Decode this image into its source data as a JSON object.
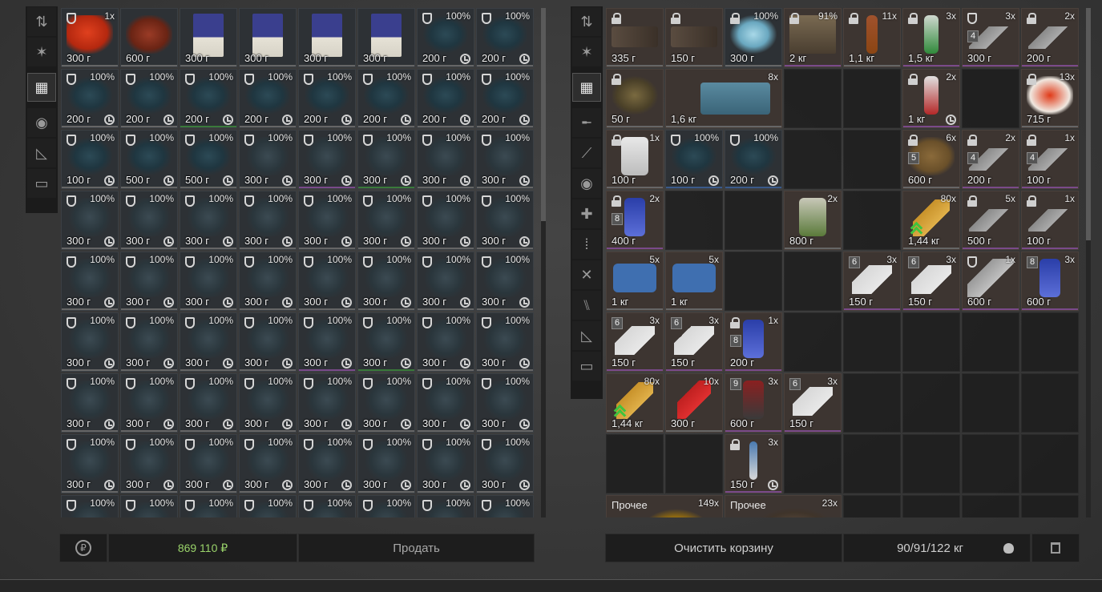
{
  "left_sidebar": [
    "sort-icon",
    "star-icon",
    "grid-icon",
    "ball-icon",
    "ruler-icon",
    "archive-icon"
  ],
  "right_sidebar": [
    "sort-icon",
    "star-icon",
    "grid-icon",
    "rifle-icon",
    "knife-icon",
    "ball-icon",
    "medkit-icon",
    "ammo-icon",
    "tools-icon",
    "food-icon",
    "ruler-icon",
    "archive-icon"
  ],
  "left_items": [
    {
      "art": "meat",
      "mark": "shield",
      "badge": "1x",
      "weight": "300 г",
      "u": "u-grey"
    },
    {
      "art": "heart",
      "badge": "",
      "weight": "600 г",
      "u": "u-grey"
    },
    {
      "art": "book",
      "weight": "300 г",
      "u": "u-grey"
    },
    {
      "art": "book",
      "weight": "300 г",
      "u": "u-grey"
    },
    {
      "art": "book",
      "weight": "300 г",
      "u": "u-grey"
    },
    {
      "art": "book",
      "weight": "300 г",
      "u": "u-grey"
    },
    {
      "art": "coral",
      "mark": "shield",
      "badge": "100%",
      "weight": "200 г",
      "clock": true,
      "u": "u-grey"
    },
    {
      "art": "coral",
      "mark": "shield",
      "badge": "100%",
      "weight": "200 г",
      "clock": true,
      "u": "u-grey"
    },
    {
      "art": "coral",
      "mark": "shield",
      "badge": "100%",
      "weight": "200 г",
      "clock": true,
      "u": "u-grey"
    },
    {
      "art": "coral",
      "mark": "shield",
      "badge": "100%",
      "weight": "200 г",
      "clock": true,
      "u": "u-grey"
    },
    {
      "art": "coral",
      "mark": "shield",
      "badge": "100%",
      "weight": "200 г",
      "clock": true,
      "u": "u-green"
    },
    {
      "art": "coral",
      "mark": "shield",
      "badge": "100%",
      "weight": "200 г",
      "clock": true,
      "u": "u-grey"
    },
    {
      "art": "coral",
      "mark": "shield",
      "badge": "100%",
      "weight": "200 г",
      "clock": true,
      "u": "u-grey"
    },
    {
      "art": "coral",
      "mark": "shield",
      "badge": "100%",
      "weight": "200 г",
      "clock": true,
      "u": "u-grey"
    },
    {
      "art": "coral",
      "mark": "shield",
      "badge": "100%",
      "weight": "200 г",
      "clock": true,
      "u": "u-grey"
    },
    {
      "art": "coral",
      "mark": "shield",
      "badge": "100%",
      "weight": "200 г",
      "clock": true,
      "u": "u-grey"
    },
    {
      "art": "coral",
      "mark": "shield",
      "badge": "100%",
      "weight": "100 г",
      "clock": true,
      "u": "u-grey"
    },
    {
      "art": "coral",
      "mark": "shield",
      "badge": "100%",
      "weight": "500 г",
      "clock": true,
      "u": "u-grey"
    },
    {
      "art": "coral",
      "mark": "shield",
      "badge": "100%",
      "weight": "500 г",
      "clock": true,
      "u": "u-grey"
    },
    {
      "art": "bush",
      "mark": "shield",
      "badge": "100%",
      "weight": "300 г",
      "clock": true,
      "u": "u-grey"
    },
    {
      "art": "bush",
      "mark": "shield",
      "badge": "100%",
      "weight": "300 г",
      "clock": true,
      "u": "u-purple"
    },
    {
      "art": "bush",
      "mark": "shield",
      "badge": "100%",
      "weight": "300 г",
      "clock": true,
      "u": "u-green"
    },
    {
      "art": "bush",
      "mark": "shield",
      "badge": "100%",
      "weight": "300 г",
      "clock": true,
      "u": "u-grey"
    },
    {
      "art": "bush",
      "mark": "shield",
      "badge": "100%",
      "weight": "300 г",
      "clock": true,
      "u": "u-grey"
    },
    {
      "art": "bush",
      "mark": "shield",
      "badge": "100%",
      "weight": "300 г",
      "clock": true,
      "u": "u-grey"
    },
    {
      "art": "bush",
      "mark": "shield",
      "badge": "100%",
      "weight": "300 г",
      "clock": true,
      "u": "u-grey"
    },
    {
      "art": "bush",
      "mark": "shield",
      "badge": "100%",
      "weight": "300 г",
      "clock": true,
      "u": "u-grey"
    },
    {
      "art": "bush",
      "mark": "shield",
      "badge": "100%",
      "weight": "300 г",
      "clock": true,
      "u": "u-grey"
    },
    {
      "art": "bush",
      "mark": "shield",
      "badge": "100%",
      "weight": "300 г",
      "clock": true,
      "u": "u-grey"
    },
    {
      "art": "bush",
      "mark": "shield",
      "badge": "100%",
      "weight": "300 г",
      "clock": true,
      "u": "u-grey"
    },
    {
      "art": "bush",
      "mark": "shield",
      "badge": "100%",
      "weight": "300 г",
      "clock": true,
      "u": "u-grey"
    },
    {
      "art": "bush",
      "mark": "shield",
      "badge": "100%",
      "weight": "300 г",
      "clock": true,
      "u": "u-grey"
    },
    {
      "art": "bush",
      "mark": "shield",
      "badge": "100%",
      "weight": "300 г",
      "clock": true,
      "u": "u-grey"
    },
    {
      "art": "bush",
      "mark": "shield",
      "badge": "100%",
      "weight": "300 г",
      "clock": true,
      "u": "u-grey"
    },
    {
      "art": "bush",
      "mark": "shield",
      "badge": "100%",
      "weight": "300 г",
      "clock": true,
      "u": "u-grey"
    },
    {
      "art": "bush",
      "mark": "shield",
      "badge": "100%",
      "weight": "300 г",
      "clock": true,
      "u": "u-grey"
    },
    {
      "art": "bush",
      "mark": "shield",
      "badge": "100%",
      "weight": "300 г",
      "clock": true,
      "u": "u-grey"
    },
    {
      "art": "bush",
      "mark": "shield",
      "badge": "100%",
      "weight": "300 г",
      "clock": true,
      "u": "u-grey"
    },
    {
      "art": "bush",
      "mark": "shield",
      "badge": "100%",
      "weight": "300 г",
      "clock": true,
      "u": "u-grey"
    },
    {
      "art": "bush",
      "mark": "shield",
      "badge": "100%",
      "weight": "300 г",
      "clock": true,
      "u": "u-grey"
    },
    {
      "art": "bush",
      "mark": "shield",
      "badge": "100%",
      "weight": "300 г",
      "clock": true,
      "u": "u-grey"
    },
    {
      "art": "bush",
      "mark": "shield",
      "badge": "100%",
      "weight": "300 г",
      "clock": true,
      "u": "u-grey"
    },
    {
      "art": "bush",
      "mark": "shield",
      "badge": "100%",
      "weight": "300 г",
      "clock": true,
      "u": "u-grey"
    },
    {
      "art": "bush",
      "mark": "shield",
      "badge": "100%",
      "weight": "300 г",
      "clock": true,
      "u": "u-grey"
    },
    {
      "art": "bush",
      "mark": "shield",
      "badge": "100%",
      "weight": "300 г",
      "clock": true,
      "u": "u-purple"
    },
    {
      "art": "bush",
      "mark": "shield",
      "badge": "100%",
      "weight": "300 г",
      "clock": true,
      "u": "u-green"
    },
    {
      "art": "bush",
      "mark": "shield",
      "badge": "100%",
      "weight": "300 г",
      "clock": true,
      "u": "u-grey"
    },
    {
      "art": "bush",
      "mark": "shield",
      "badge": "100%",
      "weight": "300 г",
      "clock": true,
      "u": "u-grey"
    },
    {
      "art": "bush",
      "mark": "shield",
      "badge": "100%",
      "weight": "300 г",
      "clock": true,
      "u": "u-grey"
    },
    {
      "art": "bush",
      "mark": "shield",
      "badge": "100%",
      "weight": "300 г",
      "clock": true,
      "u": "u-grey"
    },
    {
      "art": "bush",
      "mark": "shield",
      "badge": "100%",
      "weight": "300 г",
      "clock": true,
      "u": "u-grey"
    },
    {
      "art": "bush",
      "mark": "shield",
      "badge": "100%",
      "weight": "300 г",
      "clock": true,
      "u": "u-grey"
    },
    {
      "art": "bush",
      "mark": "shield",
      "badge": "100%",
      "weight": "300 г",
      "clock": true,
      "u": "u-grey"
    },
    {
      "art": "bush",
      "mark": "shield",
      "badge": "100%",
      "weight": "300 г",
      "clock": true,
      "u": "u-grey"
    },
    {
      "art": "bush",
      "mark": "shield",
      "badge": "100%",
      "weight": "300 г",
      "clock": true,
      "u": "u-grey"
    },
    {
      "art": "bush",
      "mark": "shield",
      "badge": "100%",
      "weight": "300 г",
      "clock": true,
      "u": "u-grey"
    },
    {
      "art": "bush",
      "mark": "shield",
      "badge": "100%",
      "weight": "300 г",
      "clock": true,
      "u": "u-grey"
    },
    {
      "art": "bush",
      "mark": "shield",
      "badge": "100%",
      "weight": "300 г",
      "clock": true,
      "u": "u-grey"
    },
    {
      "art": "bush",
      "mark": "shield",
      "badge": "100%",
      "weight": "300 г",
      "clock": true,
      "u": "u-grey"
    },
    {
      "art": "bush",
      "mark": "shield",
      "badge": "100%",
      "weight": "300 г",
      "clock": true,
      "u": "u-grey"
    },
    {
      "art": "bush",
      "mark": "shield",
      "badge": "100%",
      "weight": "300 г",
      "clock": true,
      "u": "u-grey"
    },
    {
      "art": "bush",
      "mark": "shield",
      "badge": "100%",
      "weight": "300 г",
      "clock": true,
      "u": "u-grey"
    },
    {
      "art": "bush",
      "mark": "shield",
      "badge": "100%",
      "weight": "300 г",
      "clock": true,
      "u": "u-grey"
    },
    {
      "art": "bush",
      "mark": "shield",
      "badge": "100%",
      "weight": "300 г",
      "clock": true,
      "u": "u-grey"
    },
    {
      "art": "bush",
      "mark": "shield",
      "badge": "100%",
      "weight": "",
      "clock": false,
      "u": "u-grey"
    },
    {
      "art": "bush",
      "mark": "shield",
      "badge": "100%",
      "weight": "",
      "clock": false,
      "u": "u-grey"
    },
    {
      "art": "bush",
      "mark": "shield",
      "badge": "100%",
      "weight": "",
      "clock": false,
      "u": "u-grey"
    },
    {
      "art": "bush",
      "mark": "shield",
      "badge": "100%",
      "weight": "",
      "clock": false,
      "u": "u-grey"
    },
    {
      "art": "bush",
      "mark": "shield",
      "badge": "100%",
      "weight": "",
      "clock": false,
      "u": "u-grey"
    },
    {
      "art": "bush",
      "mark": "shield",
      "badge": "100%",
      "weight": "",
      "clock": false,
      "u": "u-grey"
    },
    {
      "art": "bush",
      "mark": "shield",
      "badge": "100%",
      "weight": "",
      "clock": false,
      "u": "u-grey"
    },
    {
      "art": "bush",
      "mark": "shield",
      "badge": "100%",
      "weight": "",
      "clock": false,
      "u": "u-grey"
    }
  ],
  "right_items": [
    {
      "art": "weapon",
      "mark": "lock",
      "weight": "335 г",
      "u": "u-grey"
    },
    {
      "art": "weapon",
      "mark": "lock",
      "weight": "150 г",
      "u": "u-grey"
    },
    {
      "art": "crystal",
      "mark": "lock",
      "badge": "100%",
      "weight": "300 г",
      "u": "u-grey",
      "inv": true
    },
    {
      "art": "sign",
      "mark": "lock",
      "badge": "91%",
      "weight": "2 кг",
      "u": "u-purple"
    },
    {
      "art": "icecream",
      "mark": "lock",
      "badge": "11x",
      "weight": "1,1 кг",
      "u": "u-grey"
    },
    {
      "art": "bottle-green",
      "mark": "lock",
      "badge": "3x",
      "weight": "1,5 кг",
      "u": "u-purple"
    },
    {
      "art": "syringe",
      "mark": "shield",
      "slot": "4",
      "badge": "3x",
      "weight": "300 г",
      "u": "u-purple"
    },
    {
      "art": "syringe",
      "mark": "lock",
      "badge": "2x",
      "weight": "200 г",
      "u": "u-purple"
    },
    {
      "art": "scissors",
      "mark": "lock",
      "weight": "50 г",
      "u": "u-grey"
    },
    {
      "art": "box",
      "mark": "",
      "badge": "8x",
      "weight": "1,6 кг",
      "u": "u-grey",
      "span": 2
    },
    {
      "empty": true
    },
    {
      "empty": true
    },
    {
      "art": "bottle-red",
      "mark": "lock",
      "badge": "2x",
      "weight": "1 кг",
      "clock": true,
      "u": "u-purple"
    },
    {
      "empty": true
    },
    {
      "art": "caviar",
      "mark": "lock",
      "badge": "13x",
      "weight": "715 г",
      "u": "u-grey"
    },
    {
      "art": "jar",
      "mark": "lock",
      "badge": "1x",
      "weight": "100 г",
      "u": "u-grey"
    },
    {
      "art": "coral",
      "mark": "shield",
      "badge": "100%",
      "weight": "100 г",
      "clock": true,
      "u": "u-blue",
      "inv": true
    },
    {
      "art": "coral",
      "mark": "shield",
      "badge": "100%",
      "weight": "200 г",
      "clock": true,
      "u": "u-blue",
      "inv": true
    },
    {
      "empty": true
    },
    {
      "empty": true
    },
    {
      "art": "bread",
      "mark": "lock",
      "slot": "5",
      "badge": "6x",
      "weight": "600 г",
      "u": "u-grey"
    },
    {
      "art": "syringe",
      "mark": "lock",
      "slot": "4",
      "badge": "2x",
      "weight": "200 г",
      "u": "u-purple"
    },
    {
      "art": "syringe",
      "mark": "lock",
      "slot": "4",
      "badge": "1x",
      "weight": "100 г",
      "u": "u-purple"
    },
    {
      "art": "can-blue",
      "mark": "lock",
      "slot": "8",
      "badge": "2x",
      "weight": "400 г",
      "u": "u-purple"
    },
    {
      "empty": true
    },
    {
      "empty": true
    },
    {
      "art": "can-green",
      "badge": "2x",
      "weight": "800 г",
      "u": "u-grey"
    },
    {
      "empty": true
    },
    {
      "art": "ammo",
      "arrow": true,
      "badge": "80x",
      "weight": "1,44 кг",
      "u": "u-grey"
    },
    {
      "art": "syringe",
      "mark": "lock",
      "badge": "5x",
      "weight": "500 г",
      "u": "u-purple"
    },
    {
      "art": "syringe",
      "mark": "lock",
      "badge": "1x",
      "weight": "100 г",
      "u": "u-purple"
    },
    {
      "art": "medkit",
      "badge": "5x",
      "weight": "1 кг",
      "u": "u-grey"
    },
    {
      "art": "medkit",
      "badge": "5x",
      "weight": "1 кг",
      "u": "u-grey"
    },
    {
      "empty": true
    },
    {
      "empty": true
    },
    {
      "art": "tube",
      "slot": "6",
      "badge": "3x",
      "weight": "150 г",
      "u": "u-purple"
    },
    {
      "art": "tube",
      "slot": "6",
      "badge": "3x",
      "weight": "150 г",
      "u": "u-purple"
    },
    {
      "art": "tool",
      "mark": "shield",
      "badge": "1x",
      "weight": "600 г",
      "u": "u-purple"
    },
    {
      "art": "can-blue",
      "slot": "8",
      "badge": "3x",
      "weight": "600 г",
      "u": "u-purple"
    },
    {
      "art": "tube",
      "slot": "6",
      "badge": "3x",
      "weight": "150 г",
      "u": "u-purple"
    },
    {
      "art": "tube",
      "slot": "6",
      "badge": "3x",
      "weight": "150 г",
      "u": "u-purple"
    },
    {
      "art": "can-blue",
      "mark": "lock",
      "slot": "8",
      "badge": "1x",
      "weight": "200 г",
      "u": "u-purple"
    },
    {
      "empty": true
    },
    {
      "empty": true
    },
    {
      "empty": true
    },
    {
      "empty": true
    },
    {
      "empty": true
    },
    {
      "art": "ammo",
      "arrow": true,
      "badge": "80x",
      "weight": "1,44 кг",
      "u": "u-grey"
    },
    {
      "art": "shell",
      "badge": "10x",
      "weight": "300 г",
      "u": "u-grey"
    },
    {
      "art": "spray",
      "slot": "9",
      "badge": "3x",
      "weight": "600 г",
      "u": "u-purple"
    },
    {
      "art": "tube",
      "slot": "6",
      "badge": "3x",
      "weight": "150 г",
      "u": "u-purple"
    },
    {
      "empty": true
    },
    {
      "empty": true
    },
    {
      "empty": true
    },
    {
      "empty": true
    },
    {
      "empty": true
    },
    {
      "empty": true
    },
    {
      "art": "pen",
      "mark": "lock",
      "badge": "3x",
      "weight": "150 г",
      "clock": true,
      "u": "u-purple"
    },
    {
      "empty": true
    },
    {
      "empty": true
    },
    {
      "empty": true
    },
    {
      "empty": true
    },
    {
      "empty": true
    },
    {
      "art": "gold",
      "cat": "Прочее",
      "badge": "149x",
      "weight": "",
      "u": "u-grey",
      "span": 2
    },
    {
      "art": "gear",
      "cat": "Прочее",
      "badge": "23x",
      "weight": "",
      "u": "u-grey",
      "span": 2
    },
    {
      "empty": true
    },
    {
      "empty": true
    },
    {
      "empty": true
    },
    {
      "empty": true
    }
  ],
  "bottom_left": {
    "money": "869 110 ₽",
    "sell_label": "Продать"
  },
  "bottom_right": {
    "clear_label": "Очистить корзину",
    "weight_label": "90/91/122 кг"
  }
}
